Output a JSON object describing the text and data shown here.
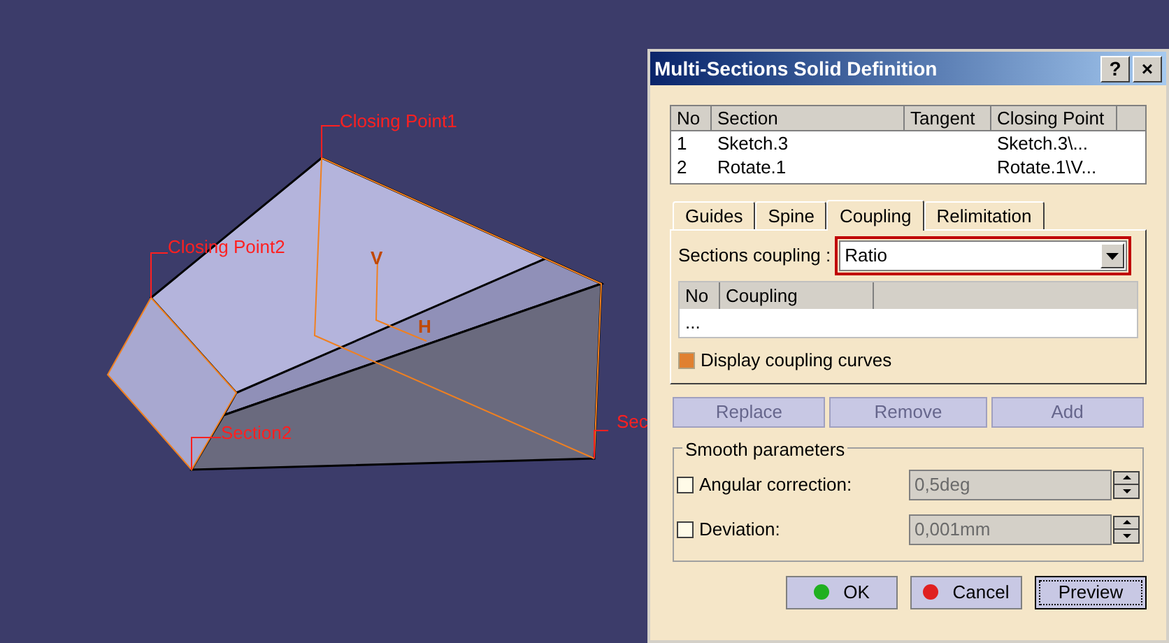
{
  "viewport": {
    "labels": [
      {
        "text": "Closing Point1",
        "kind": "callout"
      },
      {
        "text": "Closing Point2",
        "kind": "callout"
      },
      {
        "text": "Section2",
        "kind": "callout"
      },
      {
        "text": "Sec",
        "kind": "callout"
      },
      {
        "text": "V",
        "kind": "axis"
      },
      {
        "text": "H",
        "kind": "axis"
      }
    ]
  },
  "dialog": {
    "title": "Multi-Sections Solid Definition",
    "title_buttons": [
      "?",
      "×"
    ],
    "sections_table": {
      "columns": [
        "No",
        "Section",
        "Tangent",
        "Closing Point"
      ],
      "rows": [
        {
          "no": "1",
          "section": "Sketch.3",
          "tangent": "",
          "closing_point": "Sketch.3\\...",
          "selected": false
        },
        {
          "no": "2",
          "section": "Rotate.1",
          "tangent": "",
          "closing_point": "Rotate.1\\V...",
          "selected": false
        }
      ]
    },
    "tabs": [
      {
        "label": "Guides",
        "selected": false
      },
      {
        "label": "Spine",
        "selected": false
      },
      {
        "label": "Coupling",
        "selected": true
      },
      {
        "label": "Relimitation",
        "selected": false
      }
    ],
    "sections_coupling": {
      "label": "Sections coupling :",
      "value": "Ratio"
    },
    "coupling_table": {
      "columns": [
        "No",
        "Coupling"
      ],
      "rows": [
        "..."
      ]
    },
    "display_coupling_curves": {
      "label": "Display coupling curves",
      "checked": true
    },
    "list_buttons": [
      {
        "label": "Replace",
        "disabled": true
      },
      {
        "label": "Remove",
        "disabled": true
      },
      {
        "label": "Add",
        "disabled": true
      }
    ],
    "smooth_parameters": {
      "title": "Smooth parameters",
      "rows": [
        {
          "label": "Angular correction:",
          "checked": false,
          "value": "0,5deg",
          "disabled": true
        },
        {
          "label": "Deviation:",
          "checked": false,
          "value": "0,001mm",
          "disabled": true
        }
      ]
    },
    "buttons": [
      {
        "label": "OK",
        "kind": "ok"
      },
      {
        "label": "Cancel",
        "kind": "cancel"
      },
      {
        "label": "Preview",
        "kind": "preview"
      }
    ]
  }
}
